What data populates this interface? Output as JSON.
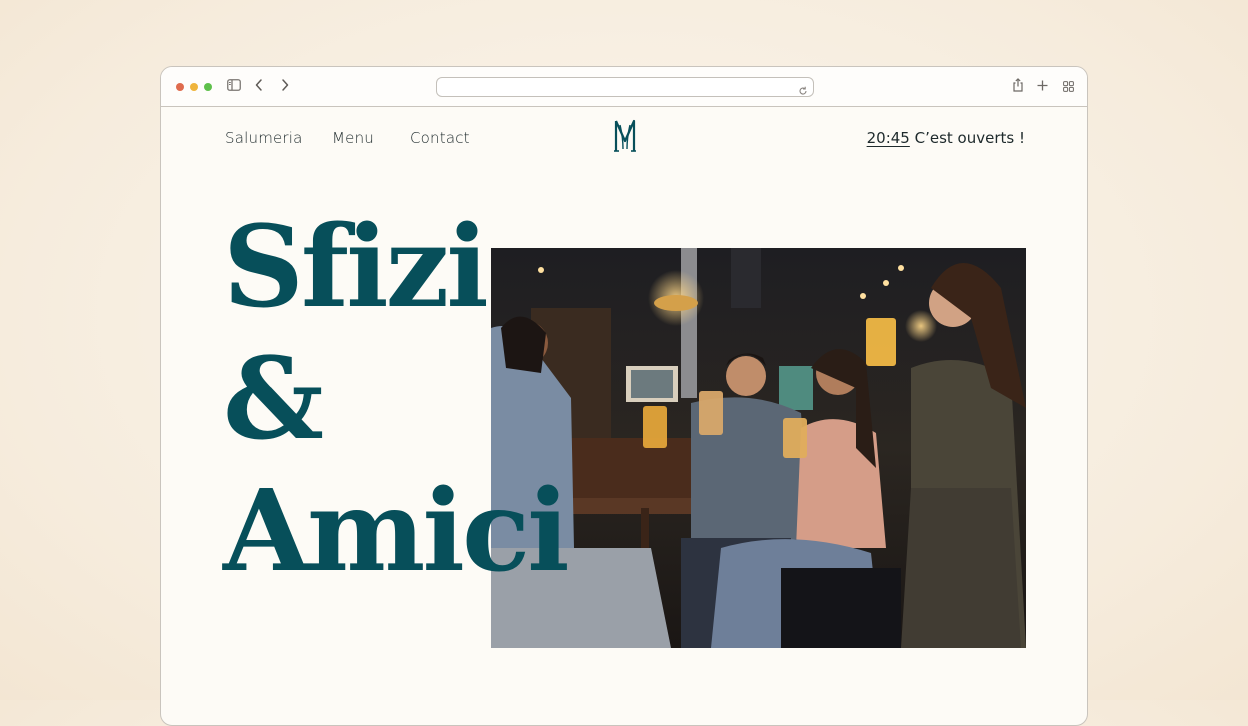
{
  "browser": {
    "controls": [
      "close",
      "minimize",
      "zoom"
    ],
    "icons": [
      "sidebar-icon",
      "back-icon",
      "forward-icon",
      "reload-icon",
      "share-icon",
      "new-tab-icon",
      "tab-overview-icon"
    ]
  },
  "nav": {
    "items": [
      "Salumeria",
      "Menu",
      "Contact"
    ],
    "hours_time": "20:45",
    "hours_status": "C’est ouverts !"
  },
  "hero": {
    "line1": "Sfizi",
    "line2": "&",
    "line3": "Amici",
    "brand_color": "#074f5a"
  }
}
